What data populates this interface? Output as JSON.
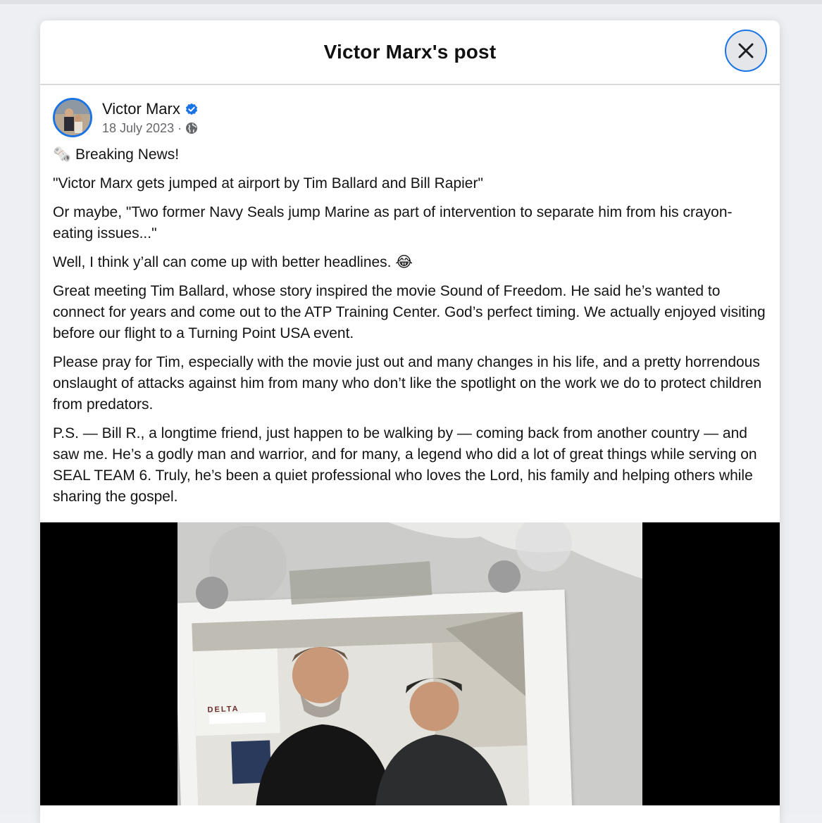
{
  "modal": {
    "title": "Victor Marx's post",
    "close_icon": "close-icon"
  },
  "post": {
    "author": "Victor Marx",
    "verified_icon": "verified-badge-icon",
    "date": "18 July 2023",
    "separator": "·",
    "privacy_icon": "globe-icon",
    "paragraphs": [
      "🗞️ Breaking News!",
      "\"Victor Marx gets jumped at airport by Tim Ballard and Bill Rapier\"",
      "Or maybe, \"Two former Navy Seals jump Marine as part of intervention to separate him from his crayon-eating issues...\"",
      "Well, I think y’all can come up with better headlines. 😂",
      "Great meeting Tim Ballard, whose story inspired the movie Sound of Freedom. He said he’s wanted to connect for years and come out to the ATP Training Center. God’s perfect timing. We actually enjoyed visiting before our flight to a Turning Point USA event.",
      "Please pray for Tim, especially with the movie just out and many changes in his life, and a pretty horrendous onslaught of attacks against him from many who don’t like the spotlight on the work we do to protect children from predators.",
      "P.S. — Bill R., a longtime friend, just happen to be walking by — coming back from another country — and saw me. He’s a godly man and warrior, and for many, a legend who did a lot of great things while serving on SEAL TEAM 6. Truly, he’s been a quiet professional who loves the Lord, his family and helping others while sharing the gospel."
    ]
  },
  "media": {
    "sign_text": "DELTA",
    "logo_icon": "heart-pulse-icon"
  },
  "colors": {
    "accent": "#1b74e4",
    "meta": "#65676b"
  }
}
